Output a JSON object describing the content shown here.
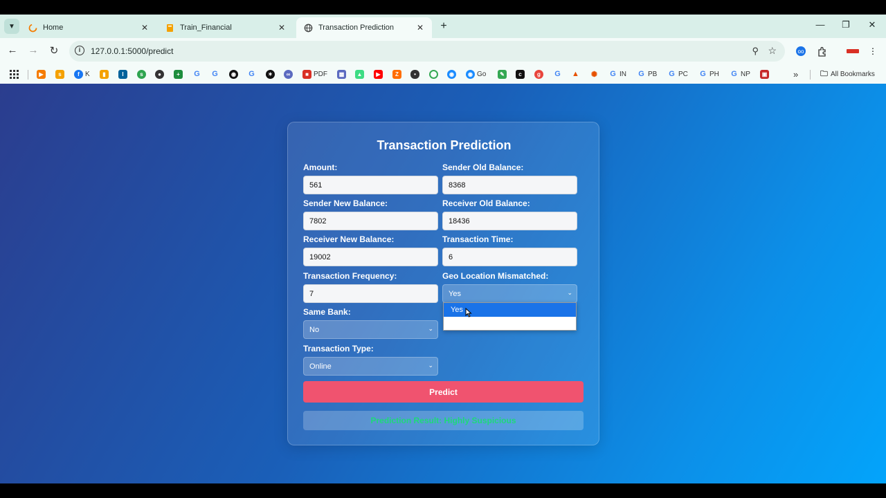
{
  "browser": {
    "tabs": [
      {
        "title": "Home",
        "icon": "loading-spinner-icon"
      },
      {
        "title": "Train_Financial",
        "icon": "notebook-icon"
      },
      {
        "title": "Transaction Prediction",
        "icon": "globe-icon"
      }
    ],
    "url": "127.0.0.1:5000/predict",
    "bookmarks": [
      {
        "label": "K",
        "color": "#1877f2",
        "icon": "facebook-icon"
      },
      {
        "label": "PDF",
        "color": "#d93025",
        "icon": "pdf-icon"
      },
      {
        "label": "Go",
        "color": "#1a8cff",
        "icon": "bookmark-icon"
      },
      {
        "label": "IN",
        "color": "#4285f4",
        "icon": "google-icon"
      },
      {
        "label": "PB",
        "color": "#4285f4",
        "icon": "google-icon"
      },
      {
        "label": "PC",
        "color": "#4285f4",
        "icon": "google-icon"
      },
      {
        "label": "PH",
        "color": "#4285f4",
        "icon": "google-icon"
      },
      {
        "label": "NP",
        "color": "#4285f4",
        "icon": "google-icon"
      }
    ],
    "all_bookmarks_label": "All Bookmarks"
  },
  "form": {
    "title": "Transaction Prediction",
    "fields": {
      "amount": {
        "label": "Amount:",
        "value": "561"
      },
      "sender_old_balance": {
        "label": "Sender Old Balance:",
        "value": "8368"
      },
      "sender_new_balance": {
        "label": "Sender New Balance:",
        "value": "7802"
      },
      "receiver_old_balance": {
        "label": "Receiver Old Balance:",
        "value": "18436"
      },
      "receiver_new_balance": {
        "label": "Receiver New Balance:",
        "value": "19002"
      },
      "transaction_time": {
        "label": "Transaction Time:",
        "value": "6"
      },
      "transaction_frequency": {
        "label": "Transaction Frequency:",
        "value": "7"
      },
      "geo_location_mismatched": {
        "label": "Geo Location Mismatched:",
        "value": "Yes"
      },
      "same_bank": {
        "label": "Same Bank:",
        "value": "No"
      },
      "transaction_type": {
        "label": "Transaction Type:",
        "value": "Online"
      }
    },
    "dropdown_options": [
      "Yes",
      ""
    ],
    "predict_label": "Predict",
    "result_text": "Prediction Result: Highly Suspicious"
  },
  "colors": {
    "predict_button": "#f0536f",
    "result_text": "#1ed97a",
    "dropdown_highlight": "#1a73e8"
  }
}
